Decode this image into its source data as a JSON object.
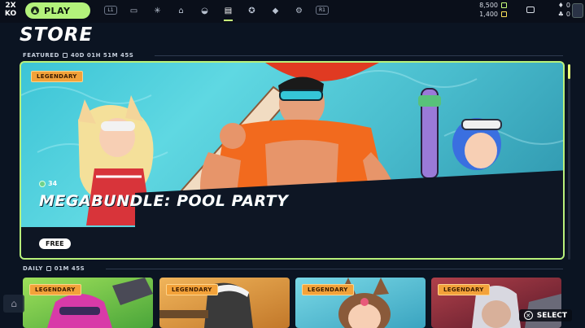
{
  "topbar": {
    "logo": "2XKO",
    "play_label": "PLAY",
    "left_bumper": "L1",
    "right_bumper": "R1",
    "nav_icons": [
      "vault-icon",
      "abilities-icon",
      "home-icon",
      "fuse-icon",
      "store-icon",
      "awards-icon",
      "learn-icon",
      "settings-icon"
    ],
    "active_nav": "store-icon",
    "currency_primary": "8,500",
    "currency_secondary": "1,400",
    "friends_count": "0",
    "party_count": "0"
  },
  "page": {
    "title": "STORE"
  },
  "featured": {
    "label": "FEATURED",
    "timer": "40D 01H 51M 45S",
    "badge": "LEGENDARY",
    "gem_count": "34",
    "name": "MEGABUNDLE: POOL PARTY",
    "price": "FREE"
  },
  "daily": {
    "label": "DAILY",
    "timer": "01M 45S",
    "cards": [
      {
        "badge": "LEGENDARY",
        "color": "#8ad44a"
      },
      {
        "badge": "LEGENDARY",
        "color": "#d79a3a"
      },
      {
        "badge": "LEGENDARY",
        "color": "#56c2d6"
      },
      {
        "badge": "LEGENDARY",
        "color": "#8a2a36"
      }
    ]
  },
  "hint": {
    "button": "✕",
    "label": "SELECT"
  },
  "colors": {
    "accent": "#b8f07a",
    "badge": "#f3a23a",
    "bg": "#0b1422"
  }
}
